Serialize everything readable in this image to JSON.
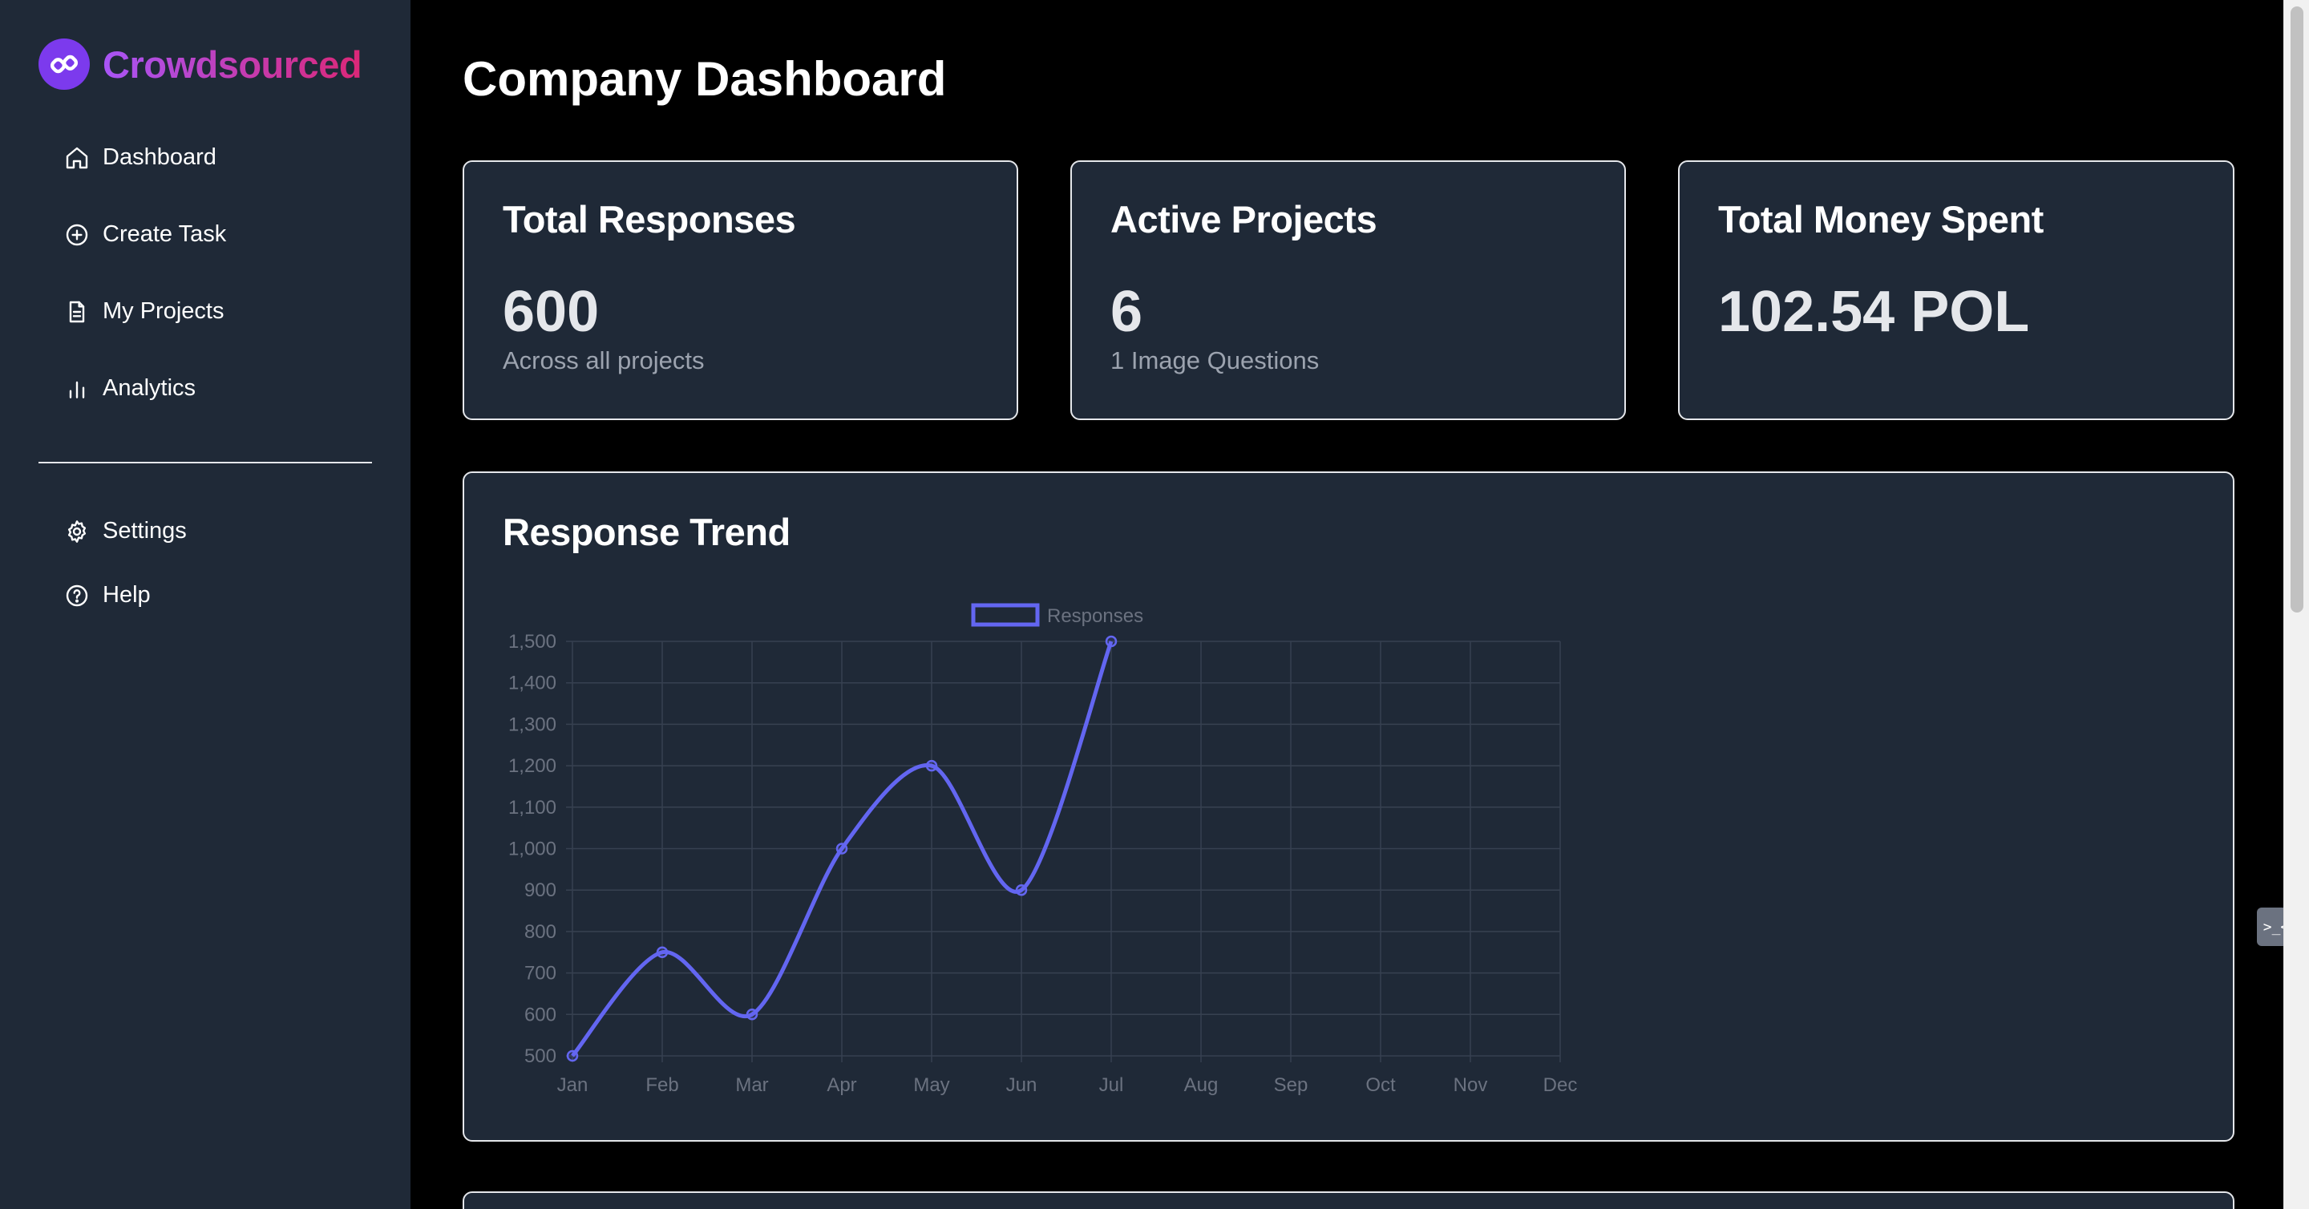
{
  "brand": {
    "name": "Crowdsourced",
    "logo_icon": "link-icon",
    "logo_color": "#7c3aed"
  },
  "sidebar": {
    "items": [
      {
        "label": "Dashboard",
        "icon": "home-icon"
      },
      {
        "label": "Create Task",
        "icon": "plus-circle-icon"
      },
      {
        "label": "My Projects",
        "icon": "document-icon"
      },
      {
        "label": "Analytics",
        "icon": "bar-chart-icon"
      }
    ],
    "secondary": [
      {
        "label": "Settings",
        "icon": "gear-icon"
      },
      {
        "label": "Help",
        "icon": "help-circle-icon"
      }
    ]
  },
  "page": {
    "title": "Company Dashboard"
  },
  "stats": [
    {
      "title": "Total Responses",
      "value": "600",
      "sub": "Across all projects"
    },
    {
      "title": "Active Projects",
      "value": "6",
      "sub": "1 Image Questions"
    },
    {
      "title": "Total Money Spent",
      "value": "102.54 POL",
      "sub": ""
    }
  ],
  "trend": {
    "title": "Response Trend"
  },
  "chart_data": {
    "type": "line",
    "title": "Response Trend",
    "categories": [
      "Jan",
      "Feb",
      "Mar",
      "Apr",
      "May",
      "Jun",
      "Jul",
      "Aug",
      "Sep",
      "Oct",
      "Nov",
      "Dec"
    ],
    "series": [
      {
        "name": "Responses",
        "values": [
          500,
          750,
          600,
          1000,
          1200,
          900,
          1500,
          null,
          null,
          null,
          null,
          null
        ],
        "color": "#6366f1"
      }
    ],
    "yticks": [
      500,
      600,
      700,
      800,
      900,
      1000,
      1100,
      1200,
      1300,
      1400,
      1500
    ],
    "ytick_labels": [
      "500",
      "600",
      "700",
      "800",
      "900",
      "1,000",
      "1,100",
      "1,200",
      "1,300",
      "1,400",
      "1,500"
    ],
    "ylim": [
      500,
      1500
    ],
    "xlabel": "",
    "ylabel": "",
    "grid": true,
    "legend": "top"
  },
  "colors": {
    "accent": "#6366f1",
    "sidebar_bg": "#1f2937",
    "card_border": "#e5e7eb",
    "muted_text": "#9ca3af",
    "grid": "#374151",
    "tick_text": "#6b7280"
  },
  "floating_tool": {
    "label": ">_<"
  }
}
